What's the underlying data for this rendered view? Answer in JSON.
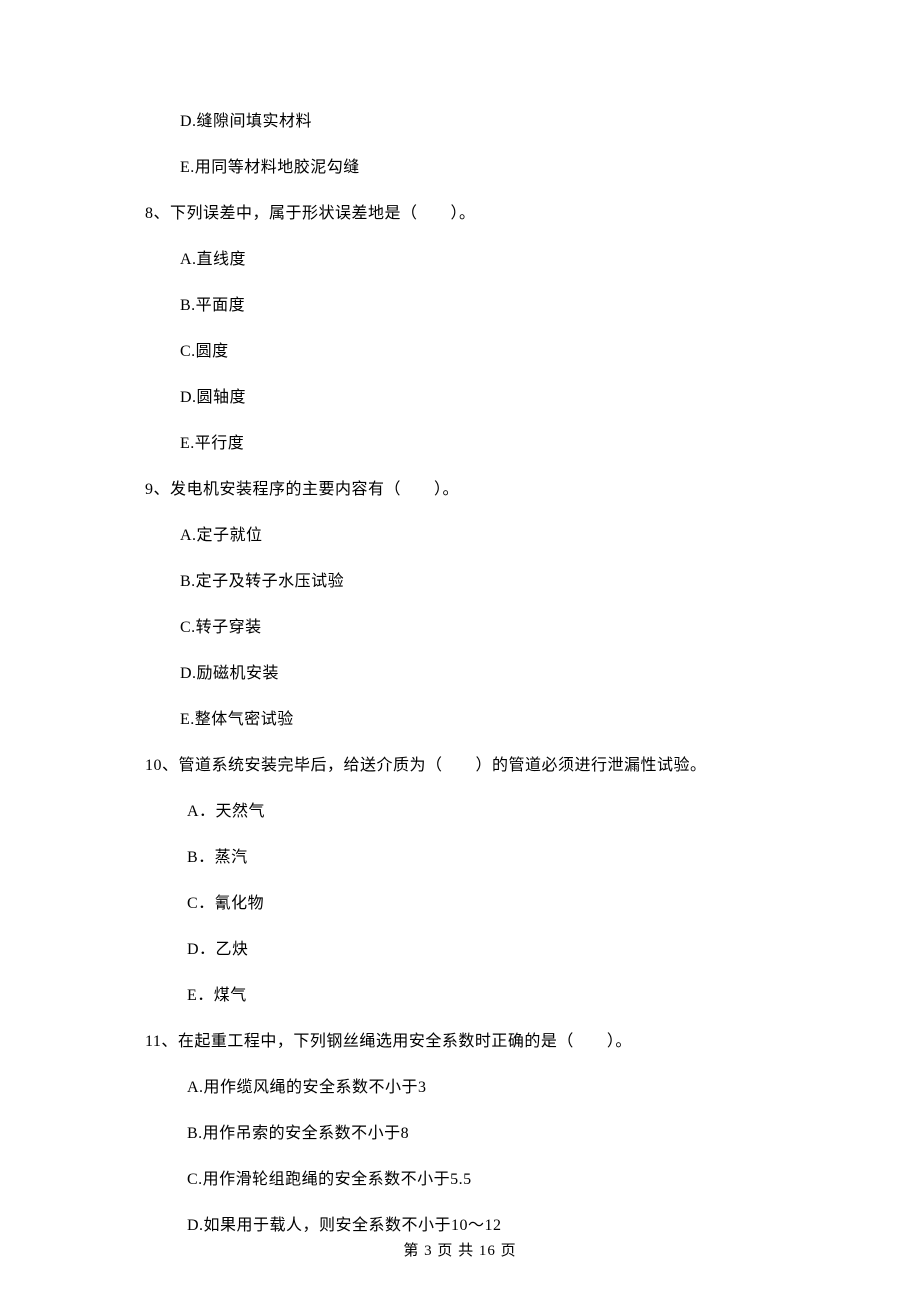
{
  "options_pre": [
    "D.缝隙间填实材料",
    "E.用同等材料地胶泥勾缝"
  ],
  "q8": {
    "stem": "8、下列误差中，属于形状误差地是（　　）。",
    "options": [
      "A.直线度",
      "B.平面度",
      "C.圆度",
      "D.圆轴度",
      "E.平行度"
    ]
  },
  "q9": {
    "stem": "9、发电机安装程序的主要内容有（　　）。",
    "options": [
      "A.定子就位",
      "B.定子及转子水压试验",
      "C.转子穿装",
      "D.励磁机安装",
      "E.整体气密试验"
    ]
  },
  "q10": {
    "stem": "10、管道系统安装完毕后，给送介质为（　　）的管道必须进行泄漏性试验。",
    "options": [
      "A．天然气",
      "B．蒸汽",
      "C．氰化物",
      "D．乙炔",
      "E．煤气"
    ]
  },
  "q11": {
    "stem": "11、在起重工程中，下列钢丝绳选用安全系数时正确的是（　　）。",
    "options": [
      "A.用作缆风绳的安全系数不小于3",
      "B.用作吊索的安全系数不小于8",
      "C.用作滑轮组跑绳的安全系数不小于5.5",
      "D.如果用于载人，则安全系数不小于10～12"
    ]
  },
  "footer": "第 3 页 共 16 页"
}
